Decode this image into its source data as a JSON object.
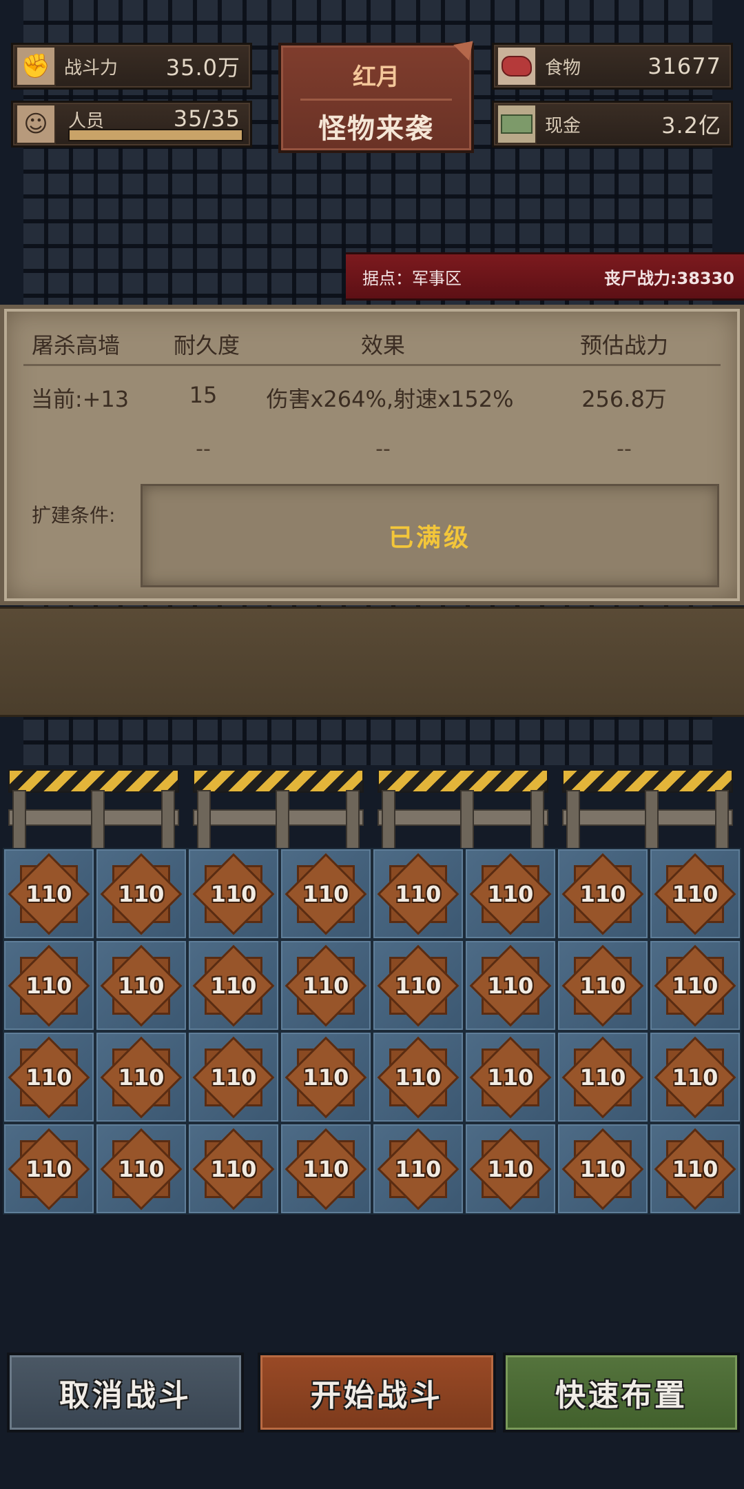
{
  "resources": {
    "power": {
      "icon": "fist-icon",
      "label": "战斗力",
      "value": "35.0万"
    },
    "staff": {
      "icon": "person-icon",
      "label": "人员",
      "value": "35/35",
      "fill": 1.0
    },
    "food": {
      "icon": "meat-icon",
      "label": "食物",
      "value": "31677"
    },
    "cash": {
      "icon": "cash-icon",
      "label": "现金",
      "value": "3.2亿"
    }
  },
  "event": {
    "title": "红月",
    "subtitle": "怪物来袭"
  },
  "stronghold": {
    "location": "据点：军事区",
    "zombie_power": "丧尸战力:38330"
  },
  "panel": {
    "headers": [
      "屠杀高墙",
      "耐久度",
      "效果",
      "预估战力"
    ],
    "current": [
      "当前:+13",
      "15",
      "伤害x264%,射速x152%",
      "256.8万"
    ],
    "next": [
      "--",
      "--",
      "--"
    ],
    "condition_label": "扩建条件:",
    "condition_value": "已满级"
  },
  "slots": [
    "110",
    "110",
    "110",
    "110",
    "110",
    "110",
    "110",
    "110",
    "110",
    "110",
    "110",
    "110",
    "110",
    "110",
    "110",
    "110",
    "110",
    "110",
    "110",
    "110",
    "110",
    "110",
    "110",
    "110",
    "110",
    "110",
    "110",
    "110",
    "110",
    "110",
    "110",
    "110"
  ],
  "buttons": {
    "cancel": "取消战斗",
    "start": "开始战斗",
    "quick": "快速布置"
  },
  "colors": {
    "accent_red": "#7c1a1e",
    "start_orange": "#9a4a26",
    "quick_green": "#55743d",
    "max_level_yellow": "#f3c63a"
  }
}
